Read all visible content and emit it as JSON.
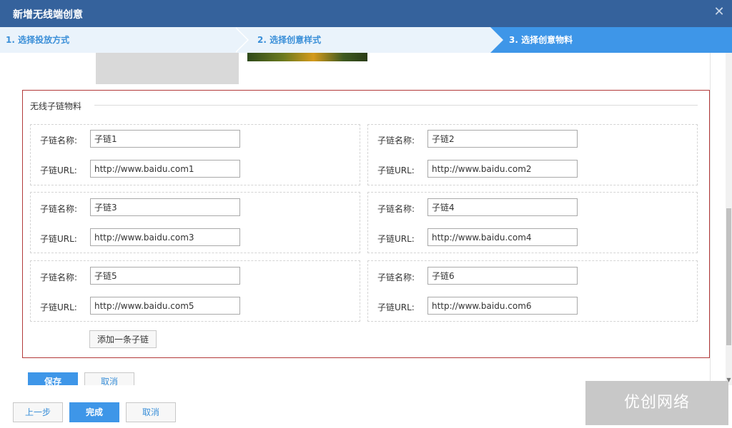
{
  "dialog": {
    "title": "新增无线端创意",
    "close_glyph": "✕"
  },
  "steps": [
    {
      "label": "1. 选择投放方式"
    },
    {
      "label": "2. 选择创意样式"
    },
    {
      "label": "3. 选择创意物料"
    }
  ],
  "sublinks": {
    "legend": "无线子链物料",
    "name_label": "子链名称:",
    "url_label": "子链URL:",
    "items": [
      {
        "name": "子链1",
        "url": "http://www.baidu.com1"
      },
      {
        "name": "子链2",
        "url": "http://www.baidu.com2"
      },
      {
        "name": "子链3",
        "url": "http://www.baidu.com3"
      },
      {
        "name": "子链4",
        "url": "http://www.baidu.com4"
      },
      {
        "name": "子链5",
        "url": "http://www.baidu.com5"
      },
      {
        "name": "子链6",
        "url": "http://www.baidu.com6"
      }
    ],
    "add_label": "添加一条子链"
  },
  "form_actions": {
    "save_label": "保存",
    "cancel_label": "取消"
  },
  "footer": {
    "prev_label": "上一步",
    "finish_label": "完成",
    "cancel_label": "取消"
  },
  "watermark": {
    "text": "优创网络"
  },
  "colors": {
    "titlebar": "#35629c",
    "active_step": "#3e96e8",
    "fieldset_border": "#b33a3a",
    "primary_button": "#3e96e8"
  }
}
